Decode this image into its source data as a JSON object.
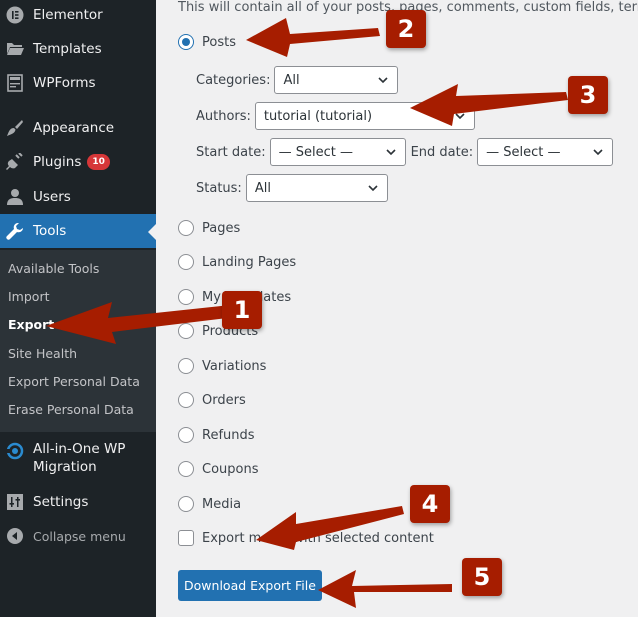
{
  "sidebar": {
    "items": [
      {
        "label": "Elementor",
        "icon": "elementor-icon"
      },
      {
        "label": "Templates",
        "icon": "folder-icon"
      },
      {
        "label": "WPForms",
        "icon": "forms-icon"
      },
      {
        "label": "Appearance",
        "icon": "paintbrush-icon"
      },
      {
        "label": "Plugins",
        "icon": "plugin-icon",
        "badge": "10"
      },
      {
        "label": "Users",
        "icon": "user-icon"
      },
      {
        "label": "Tools",
        "icon": "wrench-icon",
        "active": true
      },
      {
        "label": "All-in-One WP Migration",
        "icon": "migration-icon"
      },
      {
        "label": "Settings",
        "icon": "settings-icon"
      },
      {
        "label": "Collapse menu",
        "icon": "collapse-icon"
      }
    ],
    "all_in_one_line1": "All-in-One WP",
    "all_in_one_line2": "Migration",
    "submenu": [
      {
        "label": "Available Tools"
      },
      {
        "label": "Import"
      },
      {
        "label": "Export",
        "current": true
      },
      {
        "label": "Site Health"
      },
      {
        "label": "Export Personal Data"
      },
      {
        "label": "Erase Personal Data"
      }
    ]
  },
  "main": {
    "description": "This will contain all of your posts, pages, comments, custom fields, terms, naviga",
    "options": [
      {
        "label": "Posts",
        "checked": true
      },
      {
        "label": "Pages"
      },
      {
        "label": "Landing Pages"
      },
      {
        "label": "My Templates"
      },
      {
        "label": "Products"
      },
      {
        "label": "Variations"
      },
      {
        "label": "Orders"
      },
      {
        "label": "Refunds"
      },
      {
        "label": "Coupons"
      },
      {
        "label": "Media"
      }
    ],
    "filters": {
      "categories_label": "Categories:",
      "categories_value": "All",
      "authors_label": "Authors:",
      "authors_value": "tutorial (tutorial)",
      "start_date_label": "Start date:",
      "start_date_value": "— Select —",
      "end_date_label": "End date:",
      "end_date_value": "— Select —",
      "status_label": "Status:",
      "status_value": "All"
    },
    "export_media_label": "Export media with selected content",
    "download_button": "Download Export File"
  },
  "annotations": {
    "steps": [
      "1",
      "2",
      "3",
      "4",
      "5"
    ],
    "color": "#a61d00"
  }
}
